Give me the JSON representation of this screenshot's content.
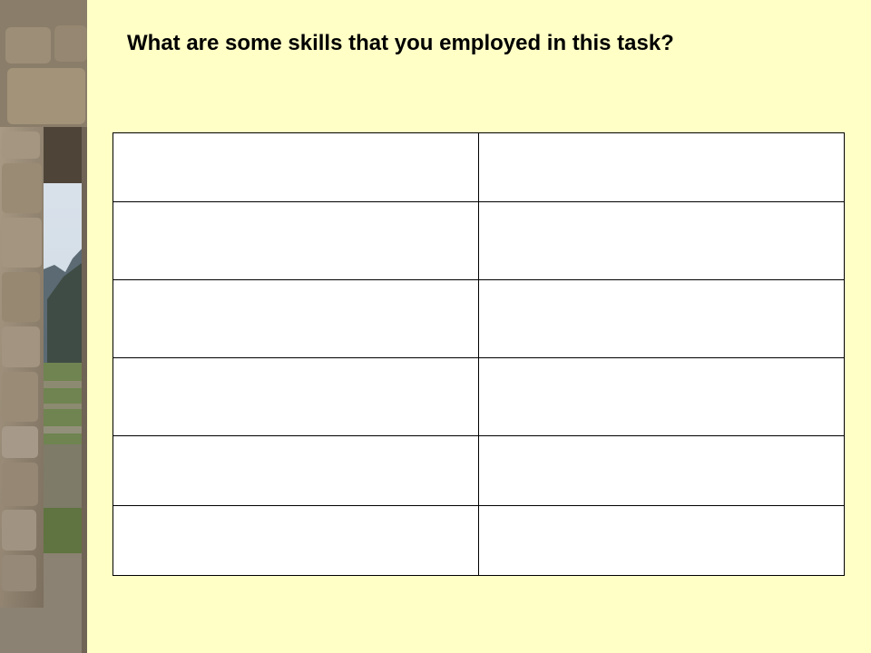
{
  "colors": {
    "background": "#ffffc6",
    "table_fill": "#ffffff",
    "table_border": "#000000",
    "title_text": "#000000"
  },
  "title": "What are some skills that you employed in this task?",
  "side_photo": {
    "subject": "stone doorway of ancient ruins with mountain view",
    "icon": "photo-stone-doorway"
  },
  "skills_table": {
    "columns": 2,
    "rows": [
      [
        "",
        ""
      ],
      [
        "",
        ""
      ],
      [
        "",
        ""
      ],
      [
        "",
        ""
      ],
      [
        "",
        ""
      ],
      [
        "",
        ""
      ]
    ]
  }
}
